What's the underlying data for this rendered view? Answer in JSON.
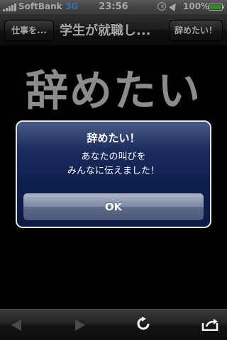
{
  "status_bar": {
    "carrier": "SoftBank",
    "network": "3G",
    "time": "23:56",
    "battery_percent": "100%",
    "icons": [
      "signal-icon",
      "lock-rotation-icon",
      "location-icon",
      "battery-icon"
    ]
  },
  "nav_bar": {
    "back_label": "仕事を...",
    "title": "学生が就職し...",
    "right_label": "辞めたい！"
  },
  "content": {
    "big_title": "辞めたい"
  },
  "alert": {
    "title": "辞めたい！",
    "message_line1": "あなたの叫びを",
    "message_line2": "みんなに伝えました！",
    "button_label": "OK"
  },
  "toolbar": {
    "icons": [
      "back-arrow-icon",
      "forward-arrow-icon",
      "reload-icon",
      "share-icon"
    ]
  },
  "colors": {
    "alert_background": "#0d1f4e",
    "network_label": "#5ab0ff",
    "battery_fill": "#4fcf3b"
  }
}
